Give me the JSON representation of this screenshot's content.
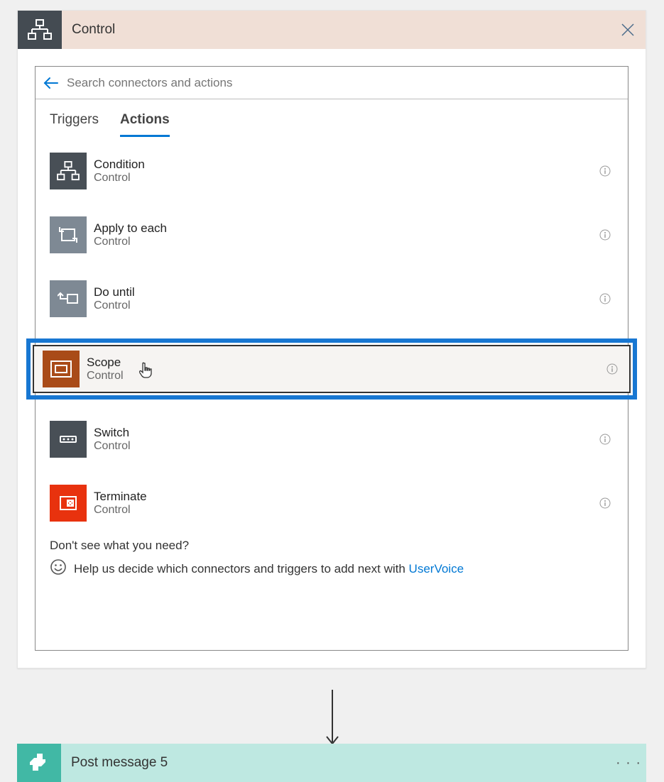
{
  "header": {
    "title": "Control"
  },
  "search": {
    "placeholder": "Search connectors and actions"
  },
  "tabs": {
    "triggers": "Triggers",
    "actions": "Actions",
    "active": "actions"
  },
  "actions": [
    {
      "title": "Condition",
      "sub": "Control",
      "icon": "condition",
      "highlighted": false
    },
    {
      "title": "Apply to each",
      "sub": "Control",
      "icon": "foreach",
      "highlighted": false
    },
    {
      "title": "Do until",
      "sub": "Control",
      "icon": "dountil",
      "highlighted": false
    },
    {
      "title": "Scope",
      "sub": "Control",
      "icon": "scope",
      "highlighted": true
    },
    {
      "title": "Switch",
      "sub": "Control",
      "icon": "switch",
      "highlighted": false
    },
    {
      "title": "Terminate",
      "sub": "Control",
      "icon": "terminate",
      "highlighted": false
    }
  ],
  "footer": {
    "question": "Don't see what you need?",
    "text": "Help us decide which connectors and triggers to add next with ",
    "link": "UserVoice"
  },
  "nextStep": {
    "title": "Post message 5"
  }
}
